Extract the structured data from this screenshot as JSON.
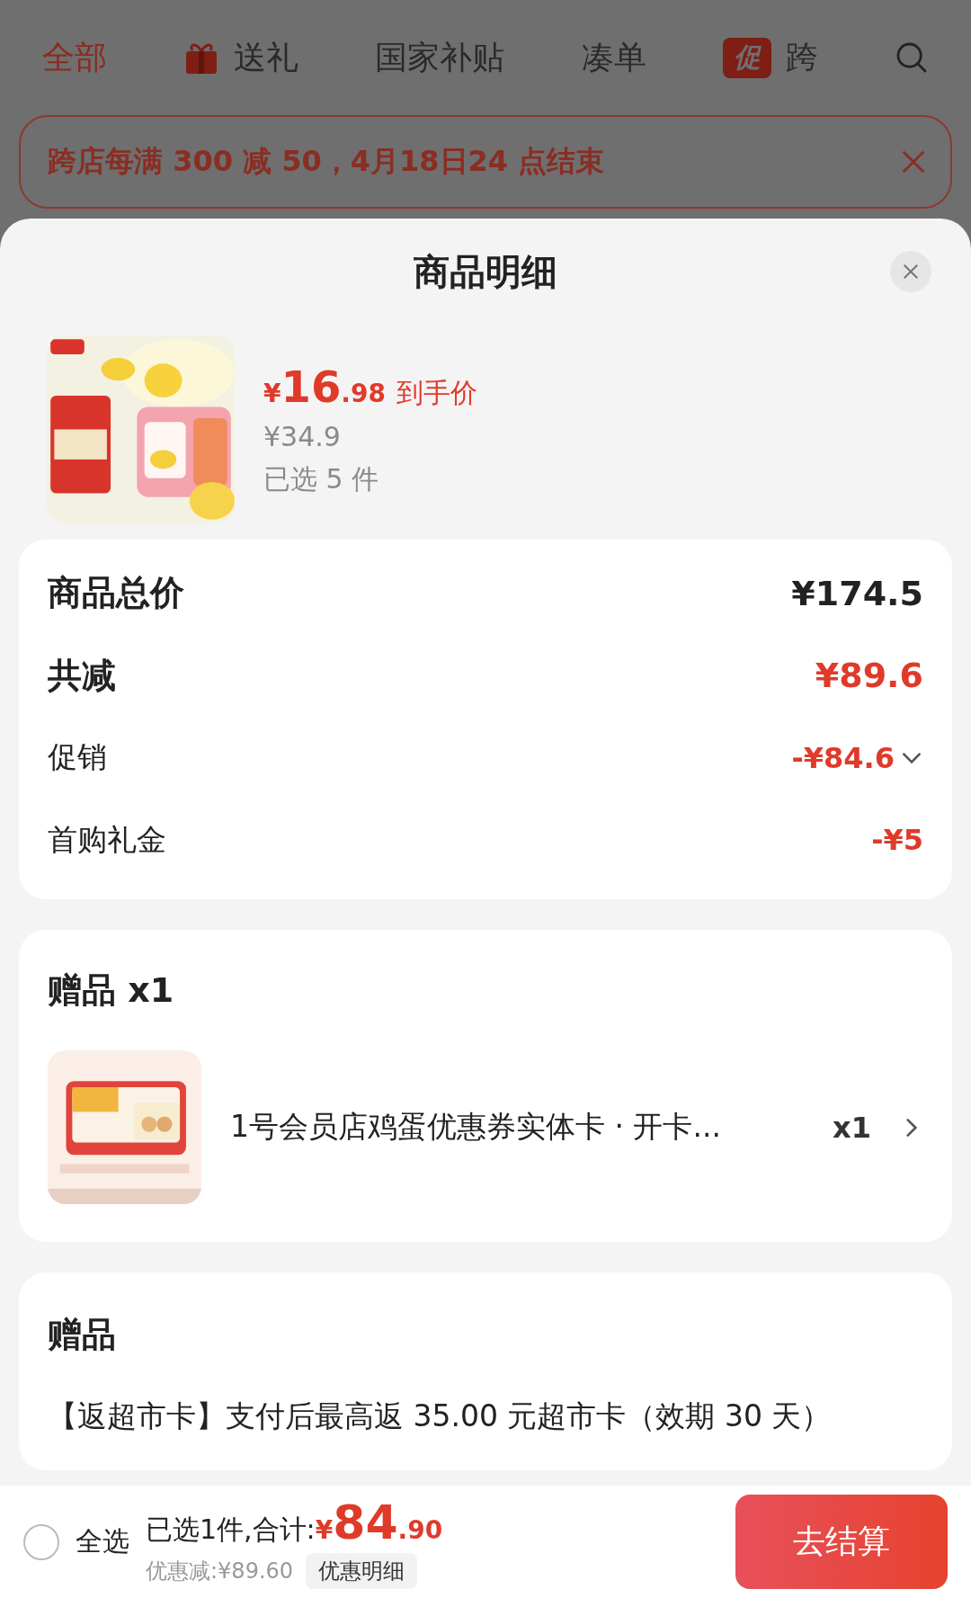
{
  "top_tabs": [
    {
      "label": "全部",
      "selected": true,
      "kind": "plain"
    },
    {
      "label": "送礼",
      "selected": false,
      "kind": "gift"
    },
    {
      "label": "国家补贴",
      "selected": false,
      "kind": "plain"
    },
    {
      "label": "凑单",
      "selected": false,
      "kind": "plain"
    },
    {
      "label": "跨",
      "badge": "促",
      "selected": false,
      "kind": "badge"
    }
  ],
  "banner": {
    "text": "跨店每满 300 减 50，4月18日24 点结束"
  },
  "sheet": {
    "title": "商品明细"
  },
  "product": {
    "currency": "¥",
    "price_int": "16",
    "price_dec": ".98",
    "price_label": "到手价",
    "original_price": "¥34.9",
    "selected_count": "已选 5 件"
  },
  "summary_rows": [
    {
      "label": "商品总价",
      "value": "¥174.5",
      "kind": "total"
    },
    {
      "label": "共减",
      "value": "¥89.6",
      "kind": "discount"
    },
    {
      "label": "促销",
      "value": "-¥84.6",
      "kind": "detail",
      "expanded": false
    },
    {
      "label": "首购礼金",
      "value": "-¥5",
      "kind": "detail"
    }
  ],
  "gift_card": {
    "title": "赠品 x1",
    "item": {
      "name": "1号会员店鸡蛋优惠券实体卡 · 开卡...",
      "quantity": "x1"
    }
  },
  "gift_note": {
    "title": "赠品",
    "text": "【返超市卡】支付后最高返 35.00 元超市卡（效期 30 天）"
  },
  "bottom_bar": {
    "select_all": {
      "label": "全选",
      "checked": false
    },
    "summary": "已选1件,合计:",
    "currency": "¥",
    "total_int": "84",
    "total_dec": ".90",
    "discount": "优惠减:¥89.60",
    "detail_button": "优惠明细",
    "checkout": "去结算"
  }
}
